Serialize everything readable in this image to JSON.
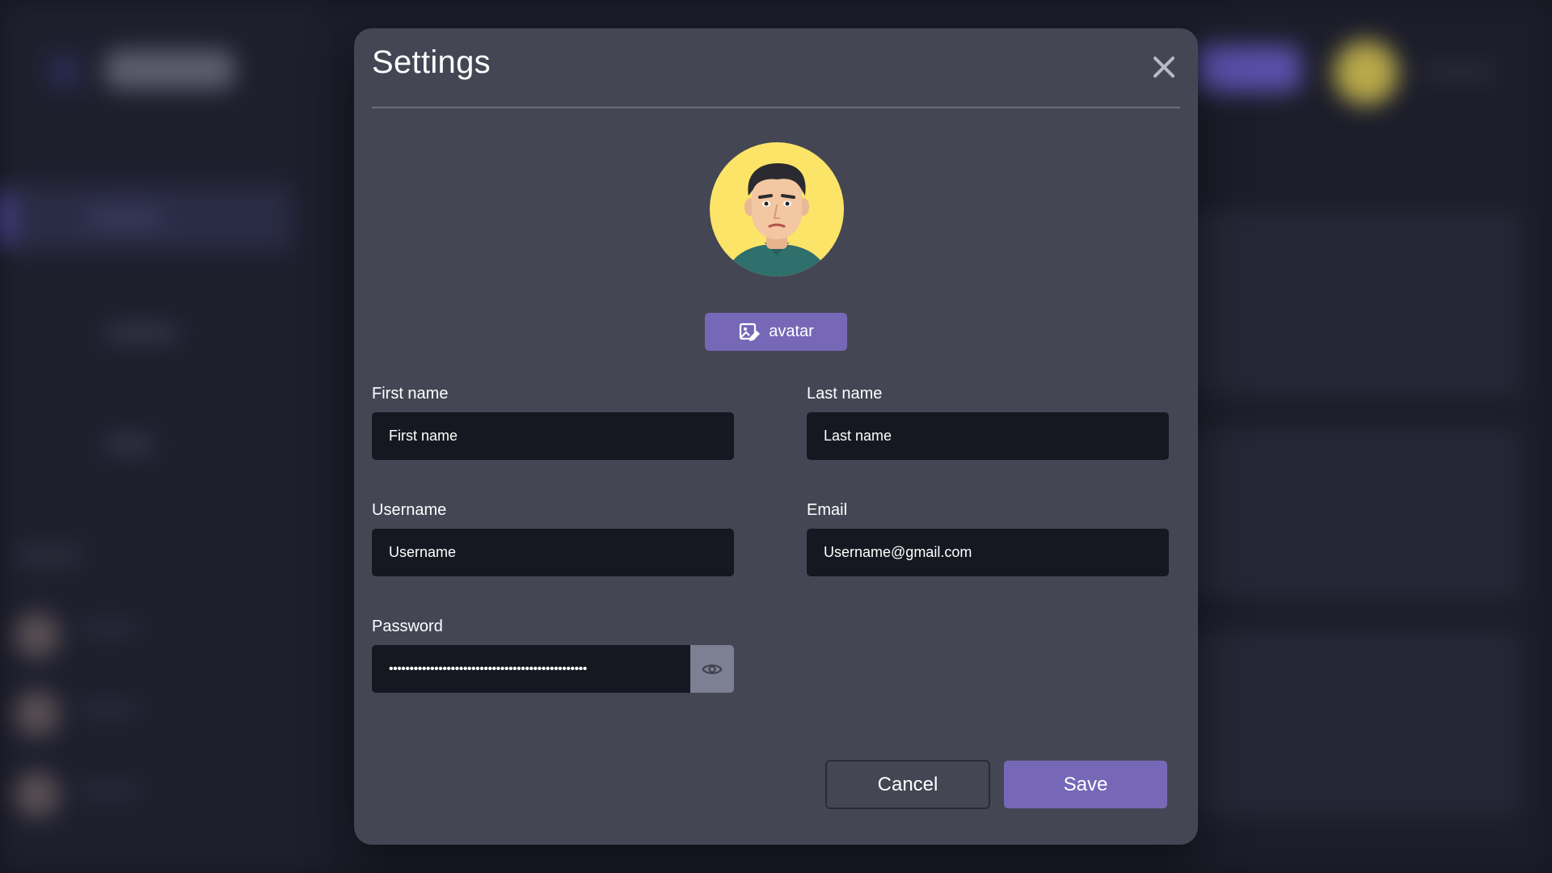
{
  "dialog": {
    "title": "Settings",
    "close_icon": "close-icon",
    "avatar_button_label": "avatar",
    "avatar_button_icon": "image-edit-icon"
  },
  "form": {
    "first_name": {
      "label": "First name",
      "placeholder": "First name",
      "value": ""
    },
    "last_name": {
      "label": "Last name",
      "placeholder": "Last name",
      "value": ""
    },
    "username": {
      "label": "Username",
      "placeholder": "Username",
      "value": ""
    },
    "email": {
      "label": "Email",
      "placeholder": "",
      "value": "Username@gmail.com"
    },
    "password": {
      "label": "Password",
      "masked_value": "••••••••••••••••••••••••••••••••••••••••••••••••",
      "toggle_icon": "eye-icon"
    }
  },
  "actions": {
    "cancel_label": "Cancel",
    "save_label": "Save"
  },
  "colors": {
    "modal_bg": "#444654",
    "accent": "#7668b7",
    "input_bg": "#161821",
    "avatar_bg": "#fbe468"
  }
}
